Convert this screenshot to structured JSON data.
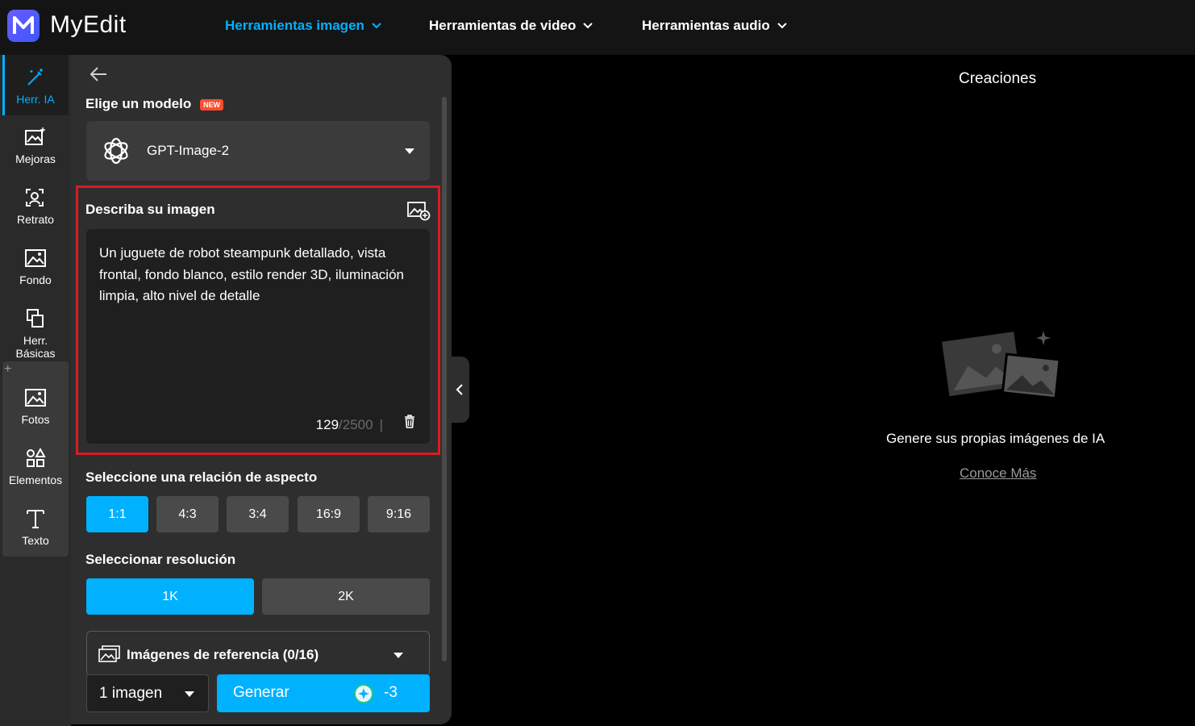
{
  "app": {
    "name": "MyEdit"
  },
  "nav": {
    "image_tools": "Herramientas imagen",
    "video_tools": "Herramientas de video",
    "audio_tools": "Herramientas audio"
  },
  "rail": {
    "items": [
      {
        "label": "Herr. IA",
        "icon": "magic-wand-icon"
      },
      {
        "label": "Mejoras",
        "icon": "image-enhance-icon"
      },
      {
        "label": "Retrato",
        "icon": "portrait-icon"
      },
      {
        "label": "Fondo",
        "icon": "background-icon"
      },
      {
        "label": "Herr. Básicas",
        "icon": "crop-icon"
      },
      {
        "label": "Fotos",
        "icon": "photo-icon"
      },
      {
        "label": "Elementos",
        "icon": "shapes-icon"
      },
      {
        "label": "Texto",
        "icon": "text-icon"
      }
    ],
    "plus": "+"
  },
  "panel": {
    "model_heading": "Elige un modelo",
    "new_badge": "NEW",
    "model_name": "GPT-Image-2",
    "prompt_heading": "Describa su imagen",
    "prompt_text": "Un juguete de robot steampunk detallado, vista frontal, fondo blanco, estilo render 3D, iluminación limpia, alto nivel de detalle",
    "char_count": "129",
    "char_max": "/2500",
    "char_sep": "|",
    "aspect_heading": "Seleccione una relación de aspecto",
    "aspect_options": [
      "1:1",
      "4:3",
      "3:4",
      "16:9",
      "9:16"
    ],
    "aspect_selected": "1:1",
    "resolution_heading": "Seleccionar resolución",
    "resolution_options": [
      "1K",
      "2K"
    ],
    "resolution_selected": "1K",
    "reference_label": "Imágenes de referencia (0/16)",
    "image_count": "1 imagen",
    "generate_label": "Generar",
    "generate_cost": "-3"
  },
  "main": {
    "title": "Creaciones",
    "empty_text": "Genere sus propias imágenes de IA",
    "learn_more": "Conoce Más"
  },
  "colors": {
    "accent": "#00b1ff",
    "highlight_border": "#d71d24",
    "new_badge": "#ff4d2e",
    "logo": "#5b57ff"
  }
}
